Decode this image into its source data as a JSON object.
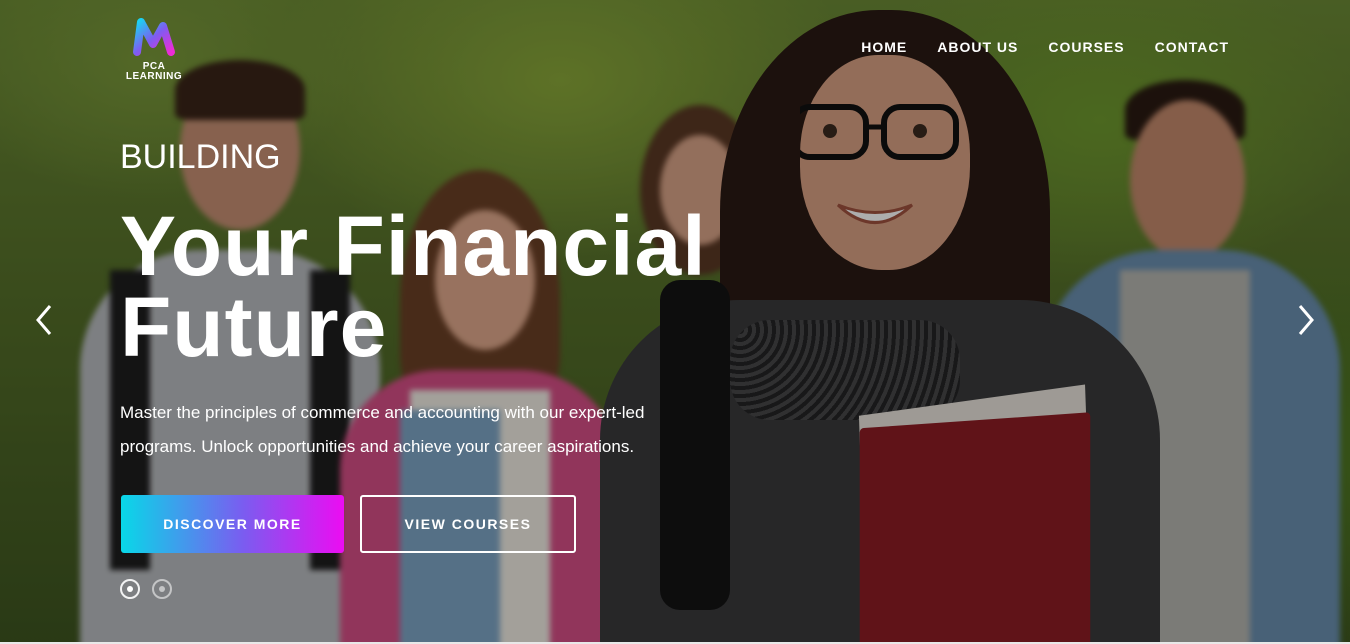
{
  "brand": {
    "logo_text_line1": "PCA",
    "logo_text_line2": "LEARNING"
  },
  "nav": {
    "items": [
      "HOME",
      "ABOUT US",
      "COURSES",
      "CONTACT"
    ]
  },
  "hero": {
    "eyebrow": "BUILDING",
    "title_line1": "Your Financial",
    "title_line2": "Future",
    "description": "Master the principles of commerce and accounting with our expert-led programs. Unlock opportunities and achieve your career aspirations.",
    "primary_button": "DISCOVER MORE",
    "secondary_button": "VIEW COURSES"
  },
  "slider": {
    "active_slide": 1,
    "total_slides": 2
  },
  "icons": {
    "prev": "chevron-left-icon",
    "next": "chevron-right-icon"
  },
  "colors": {
    "gradient_start": "#08d8e8",
    "gradient_end": "#ec0cf2",
    "text": "#ffffff"
  }
}
